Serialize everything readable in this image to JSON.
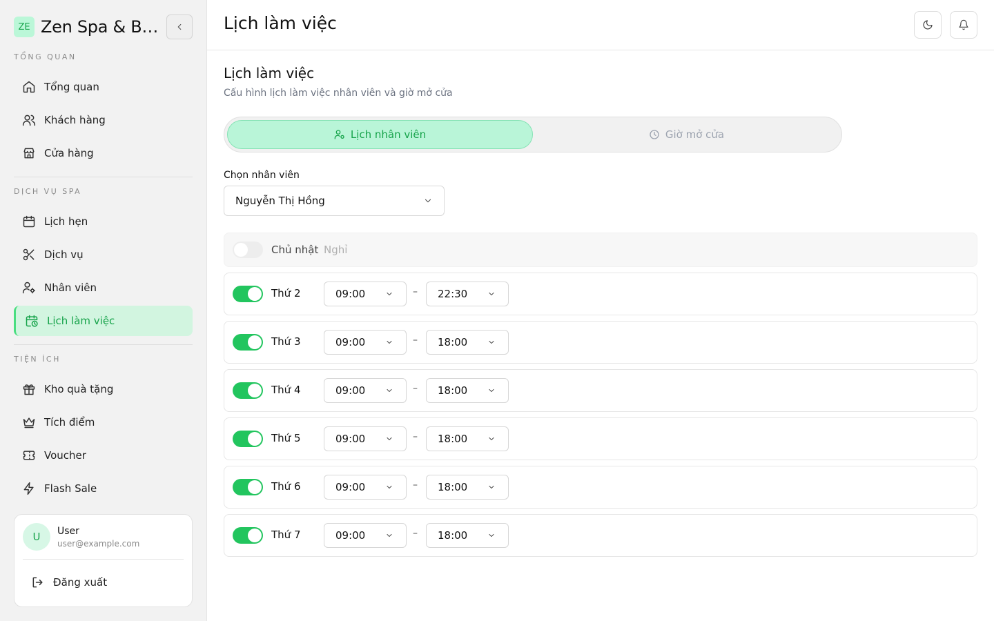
{
  "brand": {
    "logo": "ZE",
    "name": "Zen Spa & Beauty"
  },
  "sidebar": {
    "sections": [
      {
        "label": "TỔNG QUAN",
        "items": [
          {
            "label": "Tổng quan",
            "icon": "home-icon"
          },
          {
            "label": "Khách hàng",
            "icon": "users-icon"
          },
          {
            "label": "Cửa hàng",
            "icon": "store-icon"
          }
        ]
      },
      {
        "label": "DỊCH VỤ SPA",
        "items": [
          {
            "label": "Lịch hẹn",
            "icon": "calendar-icon"
          },
          {
            "label": "Dịch vụ",
            "icon": "scissors-icon"
          },
          {
            "label": "Nhân viên",
            "icon": "user-cog-icon"
          },
          {
            "label": "Lịch làm việc",
            "icon": "calendar-clock-icon",
            "active": true
          }
        ]
      },
      {
        "label": "TIỆN ÍCH",
        "items": [
          {
            "label": "Kho quà tặng",
            "icon": "gift-icon"
          },
          {
            "label": "Tích điểm",
            "icon": "crown-icon"
          },
          {
            "label": "Voucher",
            "icon": "ticket-icon"
          },
          {
            "label": "Flash Sale",
            "icon": "zap-icon"
          }
        ]
      }
    ]
  },
  "user": {
    "initial": "U",
    "name": "User",
    "email": "user@example.com",
    "logout_label": "Đăng xuất"
  },
  "header": {
    "title": "Lịch làm việc"
  },
  "main": {
    "title": "Lịch làm việc",
    "subtitle": "Cấu hình lịch làm việc nhân viên và giờ mở cửa",
    "tabs": [
      {
        "label": "Lịch nhân viên",
        "icon": "user-clock-icon",
        "active": true
      },
      {
        "label": "Giờ mở cửa",
        "icon": "clock-icon",
        "active": false
      }
    ],
    "employee_select": {
      "label": "Chọn nhân viên",
      "value": "Nguyễn Thị Hồng"
    },
    "days": [
      {
        "name": "Chủ nhật",
        "enabled": false,
        "status": "Nghỉ"
      },
      {
        "name": "Thứ 2",
        "enabled": true,
        "start": "09:00",
        "end": "22:30"
      },
      {
        "name": "Thứ 3",
        "enabled": true,
        "start": "09:00",
        "end": "18:00"
      },
      {
        "name": "Thứ 4",
        "enabled": true,
        "start": "09:00",
        "end": "18:00"
      },
      {
        "name": "Thứ 5",
        "enabled": true,
        "start": "09:00",
        "end": "18:00"
      },
      {
        "name": "Thứ 6",
        "enabled": true,
        "start": "09:00",
        "end": "18:00"
      },
      {
        "name": "Thứ 7",
        "enabled": true,
        "start": "09:00",
        "end": "18:00"
      }
    ],
    "range_separator": "–"
  },
  "colors": {
    "accent": "#22c55e",
    "accent_light": "#d2f5e0",
    "text_muted": "#6b7280"
  }
}
